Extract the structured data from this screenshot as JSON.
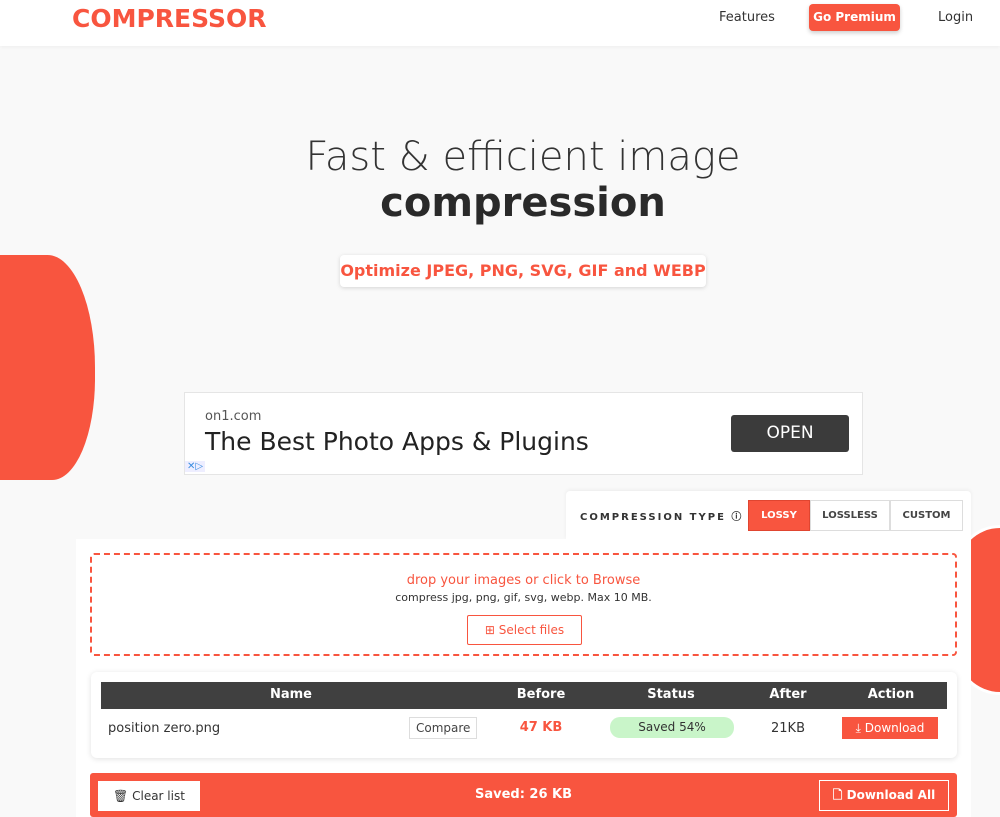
{
  "header": {
    "logo": "COMPRESSOR",
    "nav": [
      "Features",
      "Go Premium",
      "Login"
    ]
  },
  "hero": {
    "line1": "Fast & efficient image",
    "line2": "compression",
    "subtitle": "Optimize JPEG, PNG, SVG, GIF and WEBP"
  },
  "ad": {
    "domain": "on1.com",
    "title": "The Best Photo Apps & Plugins",
    "cta": "OPEN",
    "adchoices": "✕▷"
  },
  "compression": {
    "label": "COMPRESSION TYPE ⓘ :",
    "options": [
      "LOSSY",
      "LOSSLESS",
      "CUSTOM"
    ],
    "selected": "LOSSY"
  },
  "drop": {
    "title": "drop your images or click to Browse",
    "hint": "compress jpg, png, gif, svg, webp. Max 10 MB.",
    "button": "Select files"
  },
  "table": {
    "headers": [
      "Name",
      "Before",
      "Status",
      "After",
      "Action"
    ],
    "rows": [
      {
        "name": "position zero.png",
        "compare": "Compare",
        "before": "47 KB",
        "status": "Saved 54%",
        "after": "21KB",
        "action": "Download"
      }
    ]
  },
  "footer": {
    "clear": "Clear list",
    "saved": "Saved: 26 KB",
    "download_all": "Download All"
  },
  "colors": {
    "accent": "#f8553f",
    "header_dark": "#404040",
    "status_green": "#c9f5c9"
  }
}
